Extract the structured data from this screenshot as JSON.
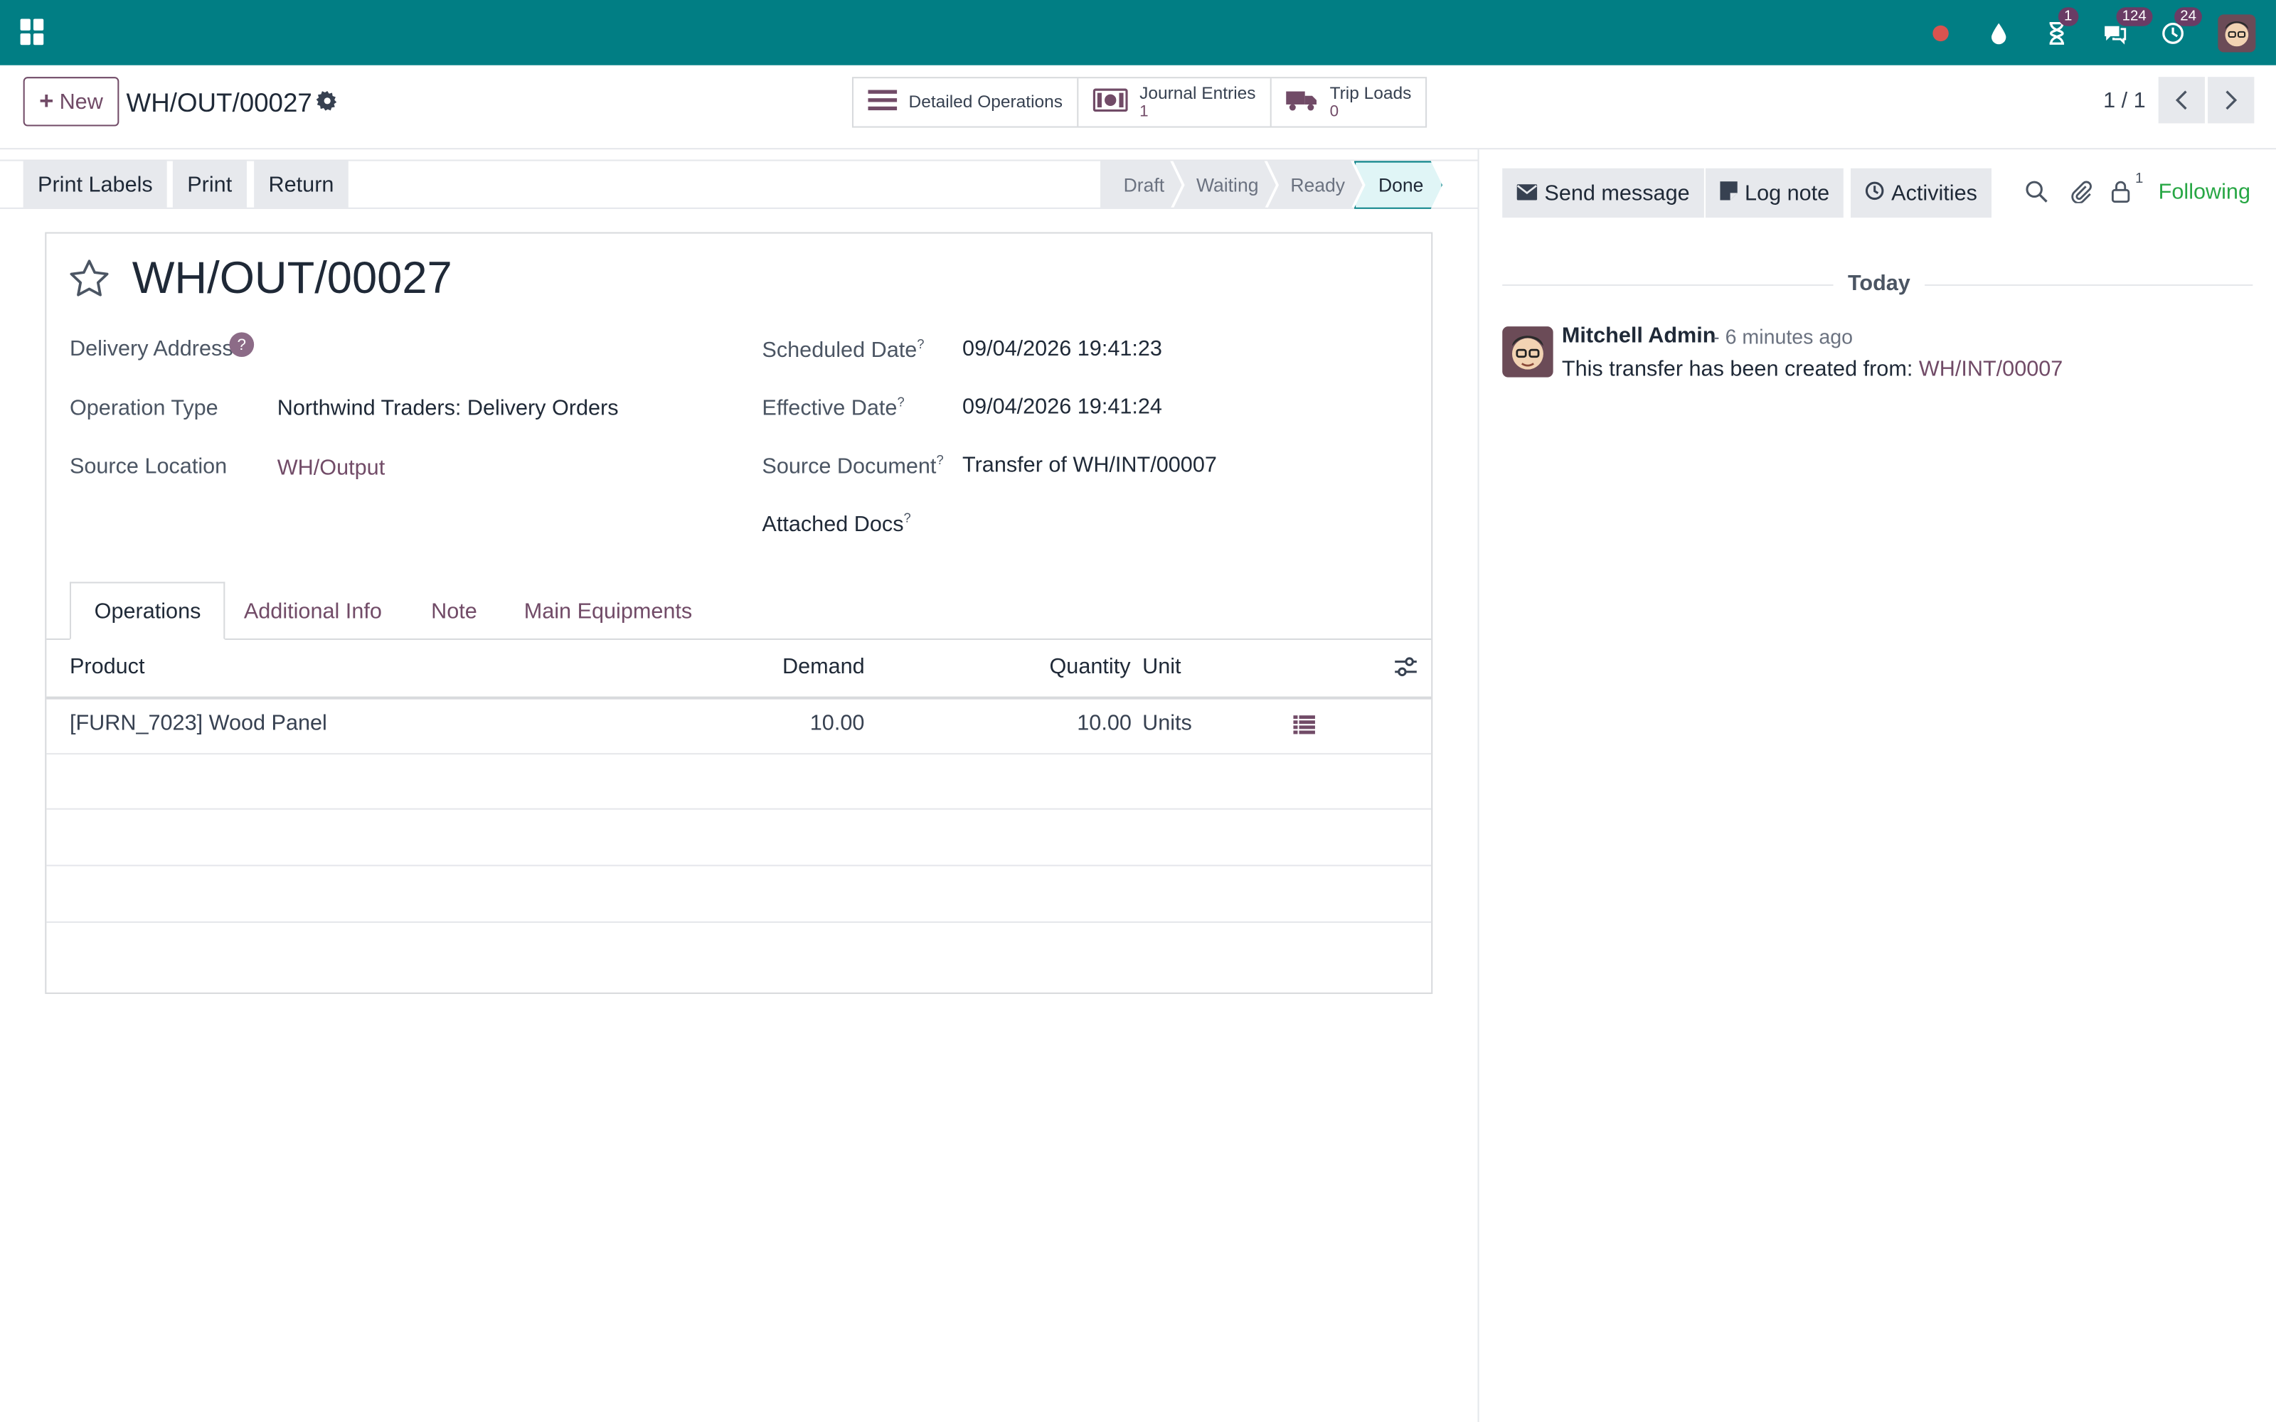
{
  "navbar": {
    "badges": {
      "activity": "1",
      "messages": "124",
      "clock": "24"
    }
  },
  "control_panel": {
    "new_label": "New",
    "plus": "+",
    "record_name": "WH/OUT/00027",
    "smart_buttons": [
      {
        "label": "Detailed Operations",
        "count": ""
      },
      {
        "label": "Journal Entries",
        "count": "1"
      },
      {
        "label": "Trip Loads",
        "count": "0"
      }
    ],
    "pager": "1 / 1"
  },
  "statusbar": {
    "buttons": [
      "Print Labels",
      "Print",
      "Return"
    ],
    "stages": [
      "Draft",
      "Waiting",
      "Ready",
      "Done"
    ],
    "active_stage": "Done"
  },
  "chatter": {
    "send_message": "Send message",
    "log_note": "Log note",
    "activities": "Activities",
    "followers_count": "1",
    "following": "Following",
    "today": "Today",
    "message": {
      "author": "Mitchell Admin",
      "time": "- 6 minutes ago",
      "text": "This transfer has been created from: ",
      "link": "WH/INT/00007"
    }
  },
  "form": {
    "title": "WH/OUT/00027",
    "help_mark": "?",
    "superscript": "?",
    "left_fields": [
      {
        "label": "Delivery Address",
        "value": ""
      },
      {
        "label": "Operation Type",
        "value": "Northwind Traders: Delivery Orders"
      },
      {
        "label": "Source Location",
        "value": "WH/Output"
      }
    ],
    "right_fields": [
      {
        "label": "Scheduled Date",
        "value": "09/04/2026 19:41:23"
      },
      {
        "label": "Effective Date",
        "value": "09/04/2026 19:41:24"
      },
      {
        "label": "Source Document",
        "value": "Transfer of WH/INT/00007"
      },
      {
        "label": "Attached Docs",
        "value": ""
      }
    ],
    "tabs": [
      "Operations",
      "Additional Info",
      "Note",
      "Main Equipments"
    ],
    "active_tab": "Operations",
    "table": {
      "headers": [
        "Product",
        "Demand",
        "Quantity",
        "Unit"
      ],
      "rows": [
        {
          "product": "[FURN_7023] Wood Panel",
          "demand": "10.00",
          "quantity": "10.00",
          "unit": "Units"
        }
      ]
    }
  },
  "colors": {
    "navbar": "#017e84",
    "brand": "#714b67",
    "following": "#28a745"
  }
}
